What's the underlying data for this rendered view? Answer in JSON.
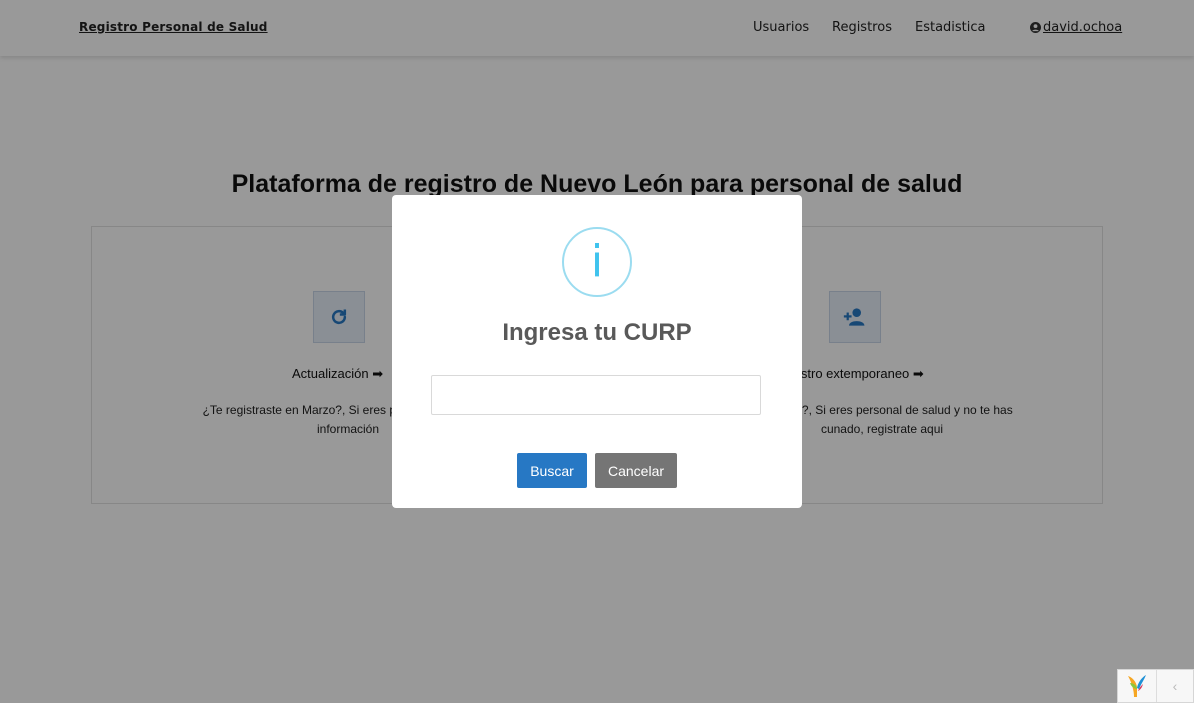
{
  "navbar": {
    "brand": "Registro Personal de Salud",
    "links": [
      "Usuarios",
      "Registros",
      "Estadistica"
    ],
    "user": "david.ochoa",
    "user_icon": "user-circle-icon"
  },
  "main": {
    "headline": "Plataforma de registro de Nuevo León para personal de salud",
    "cards": [
      {
        "icon": "refresh-icon",
        "title": "Actualización",
        "arrow": "➡",
        "description_line1": "¿Te registraste en Marzo?, Si eres personal de salud y",
        "description_line2": "información"
      },
      {
        "icon": "user-plus-icon",
        "title": "istro extemporaneo",
        "arrow": "➡",
        "description_line1": "riormente?, Si eres personal de salud y no te has",
        "description_line2": "cunado, registrate aqui"
      }
    ]
  },
  "modal": {
    "icon_glyph": "i",
    "title": "Ingresa tu CURP",
    "input_value": "",
    "confirm_label": "Buscar",
    "cancel_label": "Cancelar",
    "colors": {
      "confirm": "#2778c4",
      "cancel": "#757575",
      "info": "#3fc3ee"
    }
  },
  "debug_toolbar": {
    "logo": "yii-logo-icon",
    "toggle_glyph": "‹"
  }
}
